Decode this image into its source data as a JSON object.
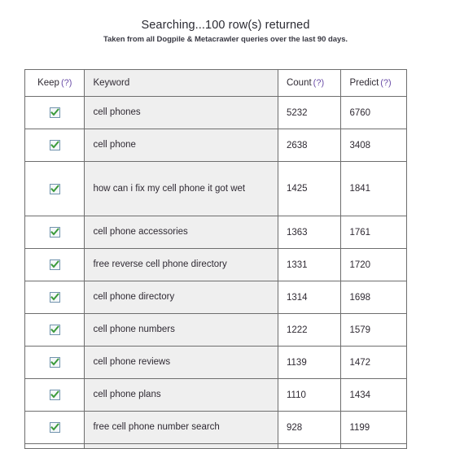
{
  "header": {
    "status": "Searching...100 row(s) returned",
    "subtitle": "Taken from all Dogpile & Metacrawler queries over the last 90 days."
  },
  "colors": {
    "help_link": "#6b4ea8",
    "check_green": "#3a9a3a",
    "check_border": "#7193ad",
    "keyword_column_bg": "#efefef",
    "border": "#6e6e6e"
  },
  "table": {
    "columns": [
      {
        "key": "keep",
        "label": "Keep",
        "help": "(?)"
      },
      {
        "key": "keyword",
        "label": "Keyword",
        "help": ""
      },
      {
        "key": "count",
        "label": "Count",
        "help": "(?)"
      },
      {
        "key": "predict",
        "label": "Predict",
        "help": "(?)"
      }
    ],
    "rows": [
      {
        "keep": true,
        "keyword": "cell phones",
        "count": "5232",
        "predict": "6760"
      },
      {
        "keep": true,
        "keyword": "cell phone",
        "count": "2638",
        "predict": "3408"
      },
      {
        "keep": true,
        "keyword": "how can i fix my cell phone it got wet",
        "count": "1425",
        "predict": "1841"
      },
      {
        "keep": true,
        "keyword": "cell phone accessories",
        "count": "1363",
        "predict": "1761"
      },
      {
        "keep": true,
        "keyword": "free reverse cell phone directory",
        "count": "1331",
        "predict": "1720"
      },
      {
        "keep": true,
        "keyword": "cell phone directory",
        "count": "1314",
        "predict": "1698"
      },
      {
        "keep": true,
        "keyword": "cell phone numbers",
        "count": "1222",
        "predict": "1579"
      },
      {
        "keep": true,
        "keyword": "cell phone reviews",
        "count": "1139",
        "predict": "1472"
      },
      {
        "keep": true,
        "keyword": "cell phone plans",
        "count": "1110",
        "predict": "1434"
      },
      {
        "keep": true,
        "keyword": "free cell phone number search",
        "count": "928",
        "predict": "1199"
      }
    ]
  }
}
